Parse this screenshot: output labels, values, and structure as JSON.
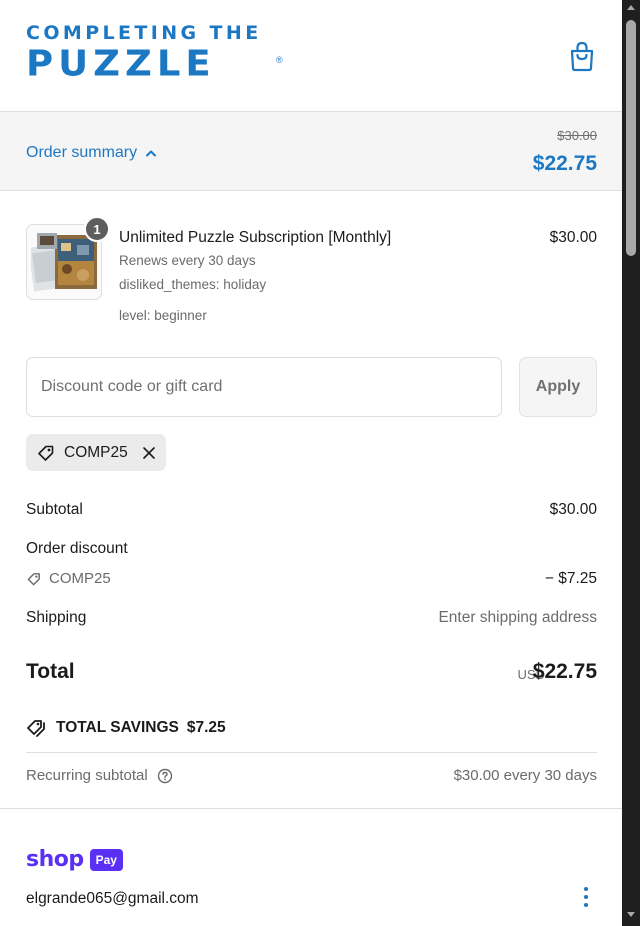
{
  "brand": {
    "logo_top": "COMPLETING THE",
    "logo_bottom": "PUZZLE",
    "logo_reg": "®",
    "accent_color": "#1d78c4"
  },
  "header": {
    "cart_icon": "shopping-bag-icon"
  },
  "summary_bar": {
    "toggle_label": "Order summary",
    "toggle_icon": "chevron-up-icon",
    "original_price": "$30.00",
    "total": "$22.75"
  },
  "product": {
    "quantity": "1",
    "name": "Unlimited Puzzle Subscription [Monthly]",
    "price": "$30.00",
    "meta": [
      "Renews every 30 days",
      "disliked_themes: holiday",
      "level: beginner"
    ]
  },
  "discount": {
    "placeholder": "Discount code or gift card",
    "apply_label": "Apply",
    "applied_code": "COMP25"
  },
  "totals": {
    "subtotal_label": "Subtotal",
    "subtotal_value": "$30.00",
    "order_discount_label": "Order discount",
    "discount_code": "COMP25",
    "discount_value": "− $7.25",
    "shipping_label": "Shipping",
    "shipping_value": "Enter shipping address",
    "total_label": "Total",
    "currency": "USD",
    "total_value": "$22.75",
    "savings_label": "TOTAL SAVINGS",
    "savings_value": "$7.25",
    "recurring_label": "Recurring subtotal",
    "recurring_value": "$30.00 every 30 days"
  },
  "shop_pay": {
    "shop_word": "shop",
    "pay_word": "Pay",
    "brand_color": "#5a31f4",
    "email": "elgrande065@gmail.com"
  }
}
